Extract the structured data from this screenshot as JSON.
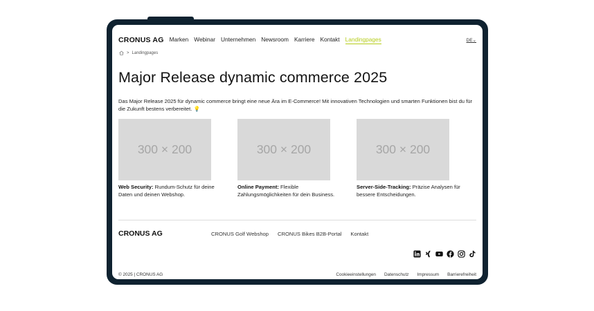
{
  "header": {
    "brand": "CRONUS AG",
    "nav": [
      "Marken",
      "Webinar",
      "Unternehmen",
      "Newsroom",
      "Karriere",
      "Kontakt",
      "Landingpages"
    ],
    "active_nav": "Landingpages",
    "language": "DE",
    "accent_color": "#b5cc18"
  },
  "breadcrumb": {
    "separator": ">",
    "current": "Landingpages"
  },
  "main": {
    "title": "Major Release dynamic commerce 2025",
    "intro": "Das Major Release 2025 für dynamic commerce bringt eine neue Ära im E-Commerce! Mit innovativen Technologien und smarten Funktionen bist du für die Zukunft bestens verbereitet. 💡",
    "cards": [
      {
        "image_text": "300 × 200",
        "heading": "Web Security:",
        "text": " Rundum-Schutz für deine Daten und deinen Webshop."
      },
      {
        "image_text": "300 × 200",
        "heading": "Online Payment:",
        "text": " Flexible Zahlungsmöglichkeiten für dein Business."
      },
      {
        "image_text": "300 × 200",
        "heading": "Server-Side-Tracking:",
        "text": " Präzise Analysen für bessere Entscheidungen."
      }
    ]
  },
  "footer": {
    "brand": "CRONUS AG",
    "links": [
      "CRONUS Golf Webshop",
      "CRONUS Bikes B2B-Portal",
      "Kontakt"
    ],
    "socials": [
      "linkedin-icon",
      "xing-icon",
      "youtube-icon",
      "facebook-icon",
      "instagram-icon",
      "tiktok-icon"
    ],
    "copyright": "© 2025 | CRONUS AG",
    "legal": [
      "Cookieeinstellungen",
      "Datenschutz",
      "Impressum",
      "Barrierefreiheit"
    ]
  },
  "colors": {
    "frame": "#0f2230",
    "placeholder": "#d9d9d9"
  }
}
